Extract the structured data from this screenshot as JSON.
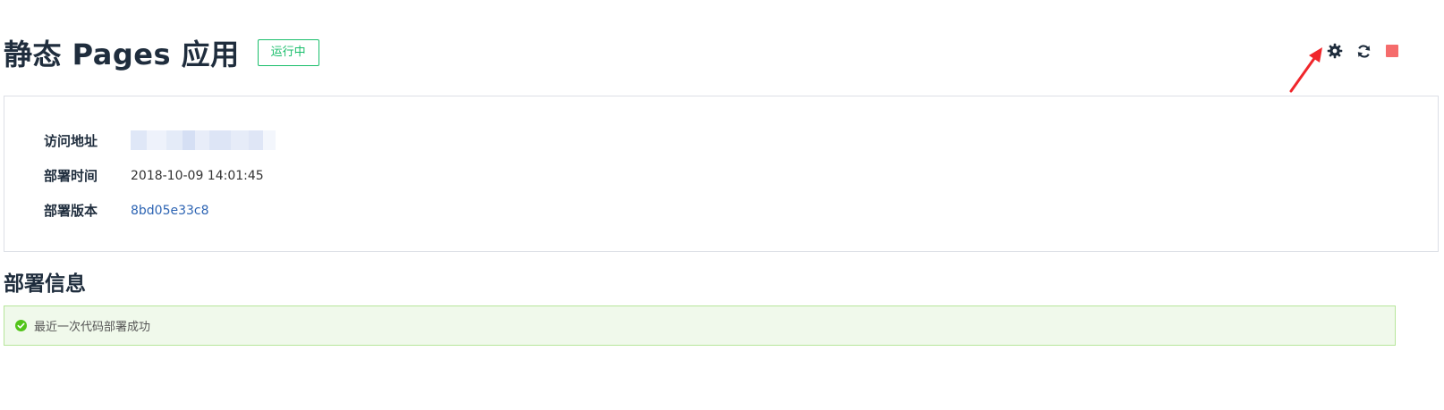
{
  "header": {
    "title": "静态 Pages 应用",
    "status": "运行中"
  },
  "toolbar": {
    "settings_icon": "gear-icon",
    "refresh_icon": "refresh-icon",
    "stop_icon": "stop-icon"
  },
  "info": {
    "rows": [
      {
        "label": "访问地址",
        "value": ""
      },
      {
        "label": "部署时间",
        "value": "2018-10-09 14:01:45"
      },
      {
        "label": "部署版本",
        "value": "8bd05e33c8"
      }
    ]
  },
  "deploy": {
    "section_title": "部署信息",
    "message": "最近一次代码部署成功"
  },
  "colors": {
    "success": "#19be6b",
    "alert_bg": "#f0f9eb",
    "stop": "#f56c6c",
    "link": "#2d64b3",
    "annotation_arrow": "#f0262b"
  }
}
